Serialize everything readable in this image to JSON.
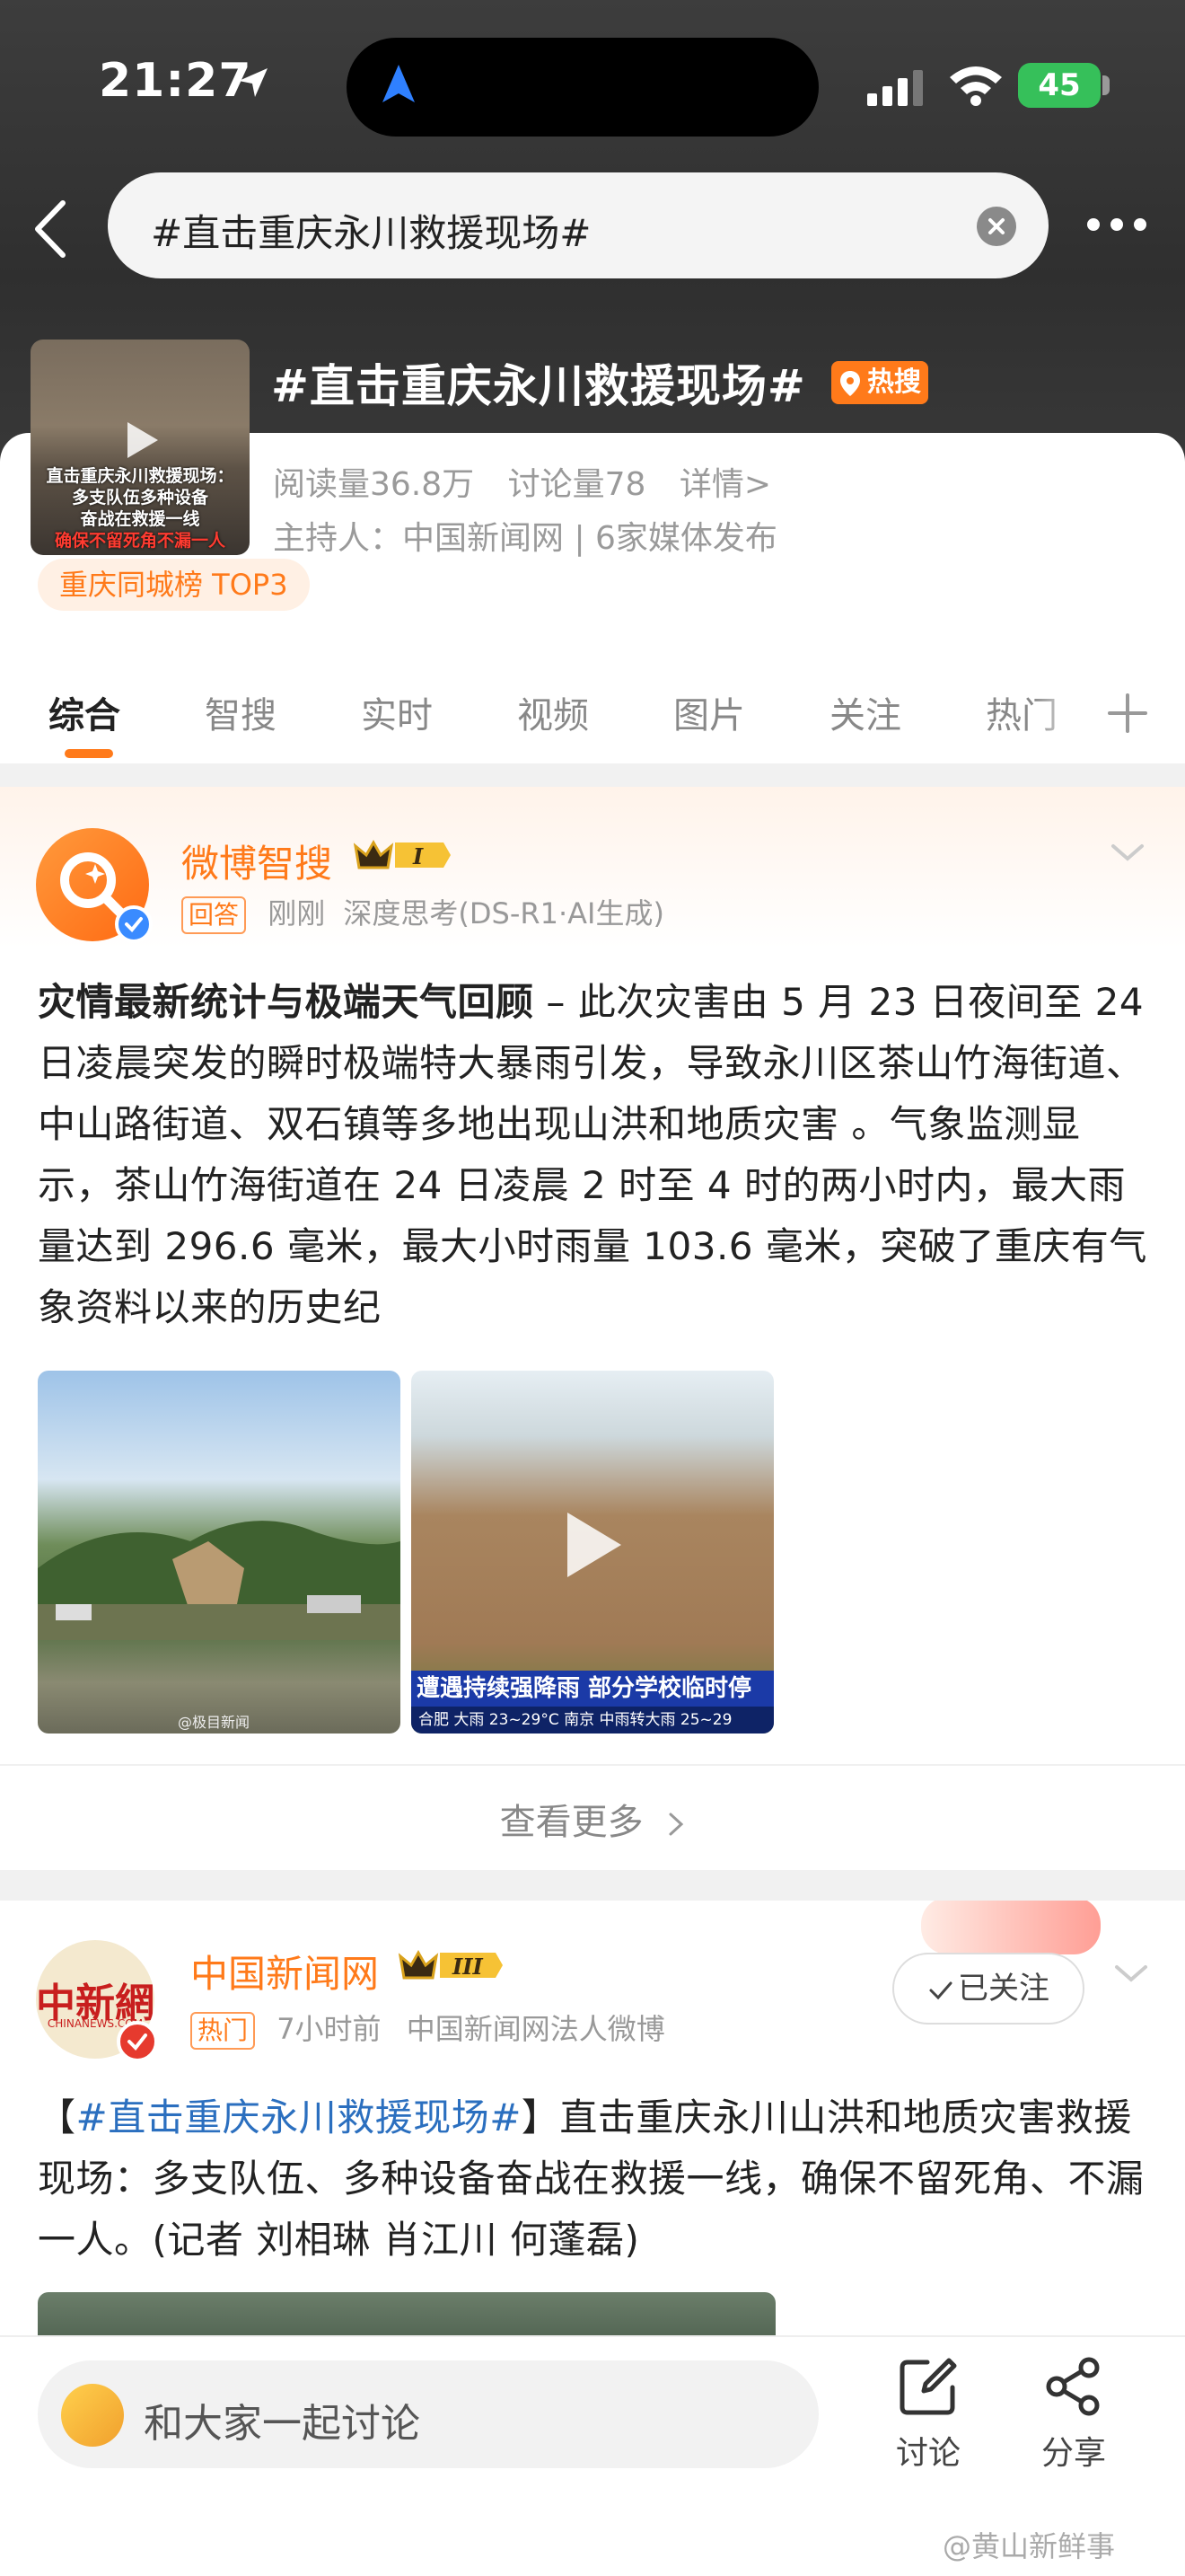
{
  "status_bar": {
    "time": "21:27",
    "battery": "45"
  },
  "search": {
    "query": "#直击重庆永川救援现场#"
  },
  "topic": {
    "title": "#直击重庆永川救援现场#",
    "hot_badge": "热搜",
    "thumb_caption_line1": "直击重庆永川救援现场：",
    "thumb_caption_line2": "多支队伍多种设备",
    "thumb_caption_line3": "奋战在救援一线",
    "thumb_caption_line4": "确保不留死角不漏一人",
    "reads": "阅读量36.8万",
    "discussions": "讨论量78",
    "details": "详情>",
    "host": "主持人：中国新闻网 | 6家媒体发布",
    "rank": "重庆同城榜 TOP3"
  },
  "tabs": [
    {
      "label": "综合"
    },
    {
      "label": "智搜"
    },
    {
      "label": "实时"
    },
    {
      "label": "视频"
    },
    {
      "label": "图片"
    },
    {
      "label": "关注"
    },
    {
      "label": "热门"
    }
  ],
  "ai_post": {
    "author": "微博智搜",
    "level": "I",
    "tag": "回答",
    "time": "刚刚",
    "source": "深度思考(DS-R1·AI生成)",
    "headline": "灾情最新统计与极端天气回顾",
    "body": " – 此次灾害由 5 月 23 日夜间至 24 日凌晨突发的瞬时极端特大暴雨引发，导致永川区茶山竹海街道、中山路街道、双石镇等多地出现山洪和地质灾害 。气象监测显示，茶山竹海街道在 24 日凌晨 2 时至 4 时的两小时内，最大雨量达到 296.6 毫米，最大小时雨量 103.6 毫米，突破了重庆有气象资料以来的历史纪",
    "media1_watermark": "@极目新闻",
    "media2_banner": "遭遇持续强降雨 部分学校临时停",
    "media2_sub": "合肥 大雨 23~29°C  南京 中雨转大雨 25~29",
    "see_more": "查看更多"
  },
  "news_post": {
    "author": "中国新闻网",
    "level": "III",
    "avatar_text": "中新網",
    "avatar_sub": "CHINANEWS.COM",
    "tag": "热门",
    "time": "7小时前",
    "source": "中国新闻网法人微博",
    "follow": "已关注",
    "bracket_open": "【",
    "hashtag": "#直击重庆永川救援现场#",
    "bracket_close": "】",
    "body": "直击重庆永川山洪和地质灾害救援现场：多支队伍、多种设备奋战在救援一线，确保不留死角、不漏一人。(记者 刘相琳 肖江川 何蓬磊)"
  },
  "bottom_bar": {
    "input_placeholder": "和大家一起讨论",
    "discuss": "讨论",
    "share": "分享",
    "watermark": "@黄山新鲜事"
  },
  "colors": {
    "accent": "#ff7a1a",
    "link": "#2b6fbf",
    "verified_blue": "#3a8bff",
    "verified_red": "#e63a2e"
  }
}
